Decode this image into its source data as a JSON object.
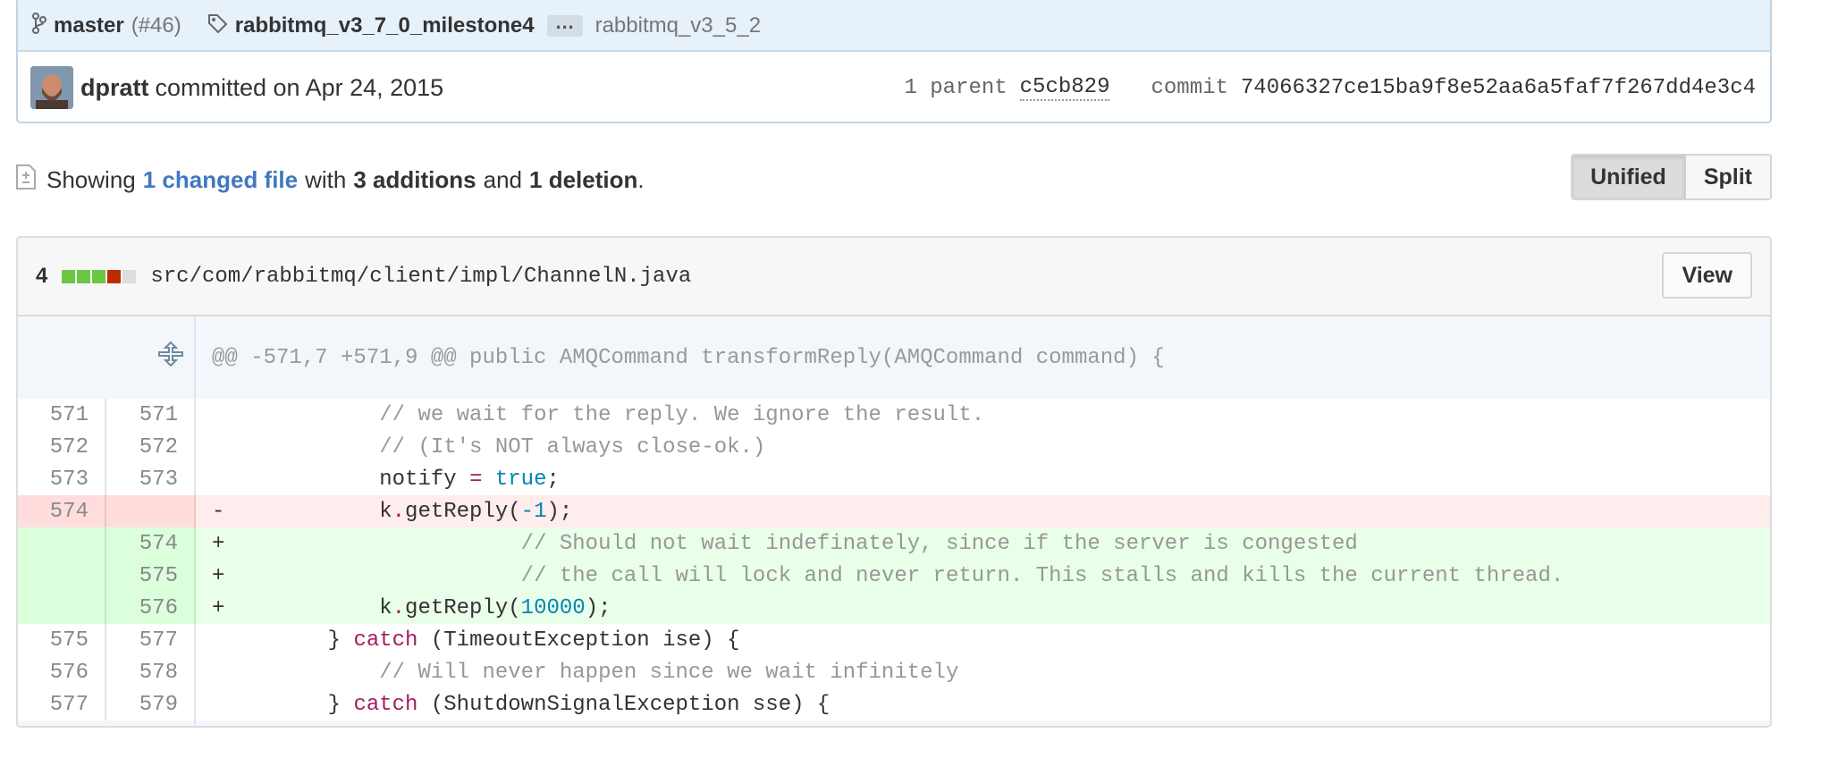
{
  "commit": {
    "branch": "master",
    "pr_ref": "(#46)",
    "tag_first": "rabbitmq_v3_7_0_milestone4",
    "ellipsis": "…",
    "tag_last": "rabbitmq_v3_5_2",
    "author": "dpratt",
    "committed_text": "committed on Apr 24, 2015",
    "parent_label": "1 parent",
    "parent_sha": "c5cb829",
    "commit_label": "commit",
    "commit_sha": "74066327ce15ba9f8e52aa6a5faf7f267dd4e3c4"
  },
  "toc": {
    "showing": "Showing",
    "changed_file": "1 changed file",
    "with": "with",
    "additions": "3 additions",
    "and": "and",
    "deletions": "1 deletion",
    "period": ".",
    "view_modes": [
      "Unified",
      "Split"
    ]
  },
  "file": {
    "change_count": "4",
    "diffstat_colors": [
      "#6cc644",
      "#6cc644",
      "#6cc644",
      "#bd2c00",
      "#dddddd"
    ],
    "path": "src/com/rabbitmq/client/impl/ChannelN.java",
    "view_label": "View",
    "hunk_header": "@@ -571,7 +571,9 @@ public AMQCommand transformReply(AMQCommand command) {",
    "lines": [
      {
        "type": "ctx",
        "old": "571",
        "new": "571",
        "sign": " ",
        "tokens": [
          {
            "t": "            "
          },
          {
            "t": "// we wait for the reply. We ignore the result.",
            "c": "cm"
          }
        ]
      },
      {
        "type": "ctx",
        "old": "572",
        "new": "572",
        "sign": " ",
        "tokens": [
          {
            "t": "            "
          },
          {
            "t": "// (It's NOT always close-ok.)",
            "c": "cm"
          }
        ]
      },
      {
        "type": "ctx",
        "old": "573",
        "new": "573",
        "sign": " ",
        "tokens": [
          {
            "t": "            notify "
          },
          {
            "t": "=",
            "c": "kw"
          },
          {
            "t": " "
          },
          {
            "t": "true",
            "c": "lit"
          },
          {
            "t": ";"
          }
        ]
      },
      {
        "type": "del",
        "old": "574",
        "new": "",
        "sign": "-",
        "tokens": [
          {
            "t": "            k"
          },
          {
            "t": ".",
            "c": "kw"
          },
          {
            "t": "getReply("
          },
          {
            "t": "-1",
            "c": "lit"
          },
          {
            "t": ");"
          }
        ]
      },
      {
        "type": "add",
        "old": "",
        "new": "574",
        "sign": "+",
        "tokens": [
          {
            "t": "                       "
          },
          {
            "t": "// Should not wait indefinately, since if the server is congested",
            "c": "cm"
          }
        ]
      },
      {
        "type": "add",
        "old": "",
        "new": "575",
        "sign": "+",
        "tokens": [
          {
            "t": "                       "
          },
          {
            "t": "// the call will lock and never return. This stalls and kills the current thread.",
            "c": "cm"
          }
        ]
      },
      {
        "type": "add",
        "old": "",
        "new": "576",
        "sign": "+",
        "tokens": [
          {
            "t": "            k"
          },
          {
            "t": ".",
            "c": "kw"
          },
          {
            "t": "getReply("
          },
          {
            "t": "10000",
            "c": "lit"
          },
          {
            "t": ");"
          }
        ]
      },
      {
        "type": "ctx",
        "old": "575",
        "new": "577",
        "sign": " ",
        "tokens": [
          {
            "t": "        } "
          },
          {
            "t": "catch",
            "c": "kw"
          },
          {
            "t": " (TimeoutException ise) {"
          }
        ]
      },
      {
        "type": "ctx",
        "old": "576",
        "new": "578",
        "sign": " ",
        "tokens": [
          {
            "t": "            "
          },
          {
            "t": "// Will never happen since we wait infinitely",
            "c": "cm"
          }
        ]
      },
      {
        "type": "ctx",
        "old": "577",
        "new": "579",
        "sign": " ",
        "tokens": [
          {
            "t": "        } "
          },
          {
            "t": "catch",
            "c": "kw"
          },
          {
            "t": " (ShutdownSignalException sse) {"
          }
        ]
      }
    ]
  }
}
